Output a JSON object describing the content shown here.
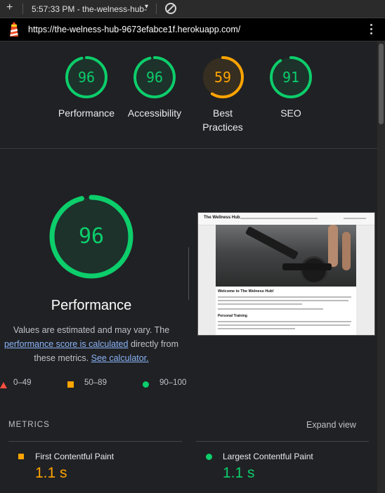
{
  "browser": {
    "new_tab_symbol": "+",
    "session_label": "5:57:33 PM - the-welness-hub-",
    "session_caret": "▾",
    "url": "https://the-welness-hub-9673efabce1f.herokuapp.com/"
  },
  "scores": [
    {
      "label": "Performance",
      "value": "96",
      "score": 0.96,
      "color": "#0cce6b"
    },
    {
      "label": "Accessibility",
      "value": "96",
      "score": 0.96,
      "color": "#0cce6b"
    },
    {
      "label": "Best Practices",
      "value": "59",
      "score": 0.59,
      "color": "#ffa400"
    },
    {
      "label": "SEO",
      "value": "91",
      "score": 0.91,
      "color": "#0cce6b"
    }
  ],
  "performance": {
    "value": "96",
    "score": 0.96,
    "title": "Performance",
    "note_1": "Values are estimated and may vary. The",
    "link_score": "performance score is calculated",
    "note_2": "directly from these metrics.",
    "link_calculator": "See calculator."
  },
  "legend": {
    "fail": "0–49",
    "average": "50–89",
    "pass": "90–100"
  },
  "screenshot": {
    "brand": "The Wellness Hub",
    "heading": "Welcome to The Welness Hub!",
    "subheading": "Personal Training"
  },
  "metrics": {
    "section_label": "METRICS",
    "expand_label": "Expand view",
    "items": [
      {
        "name": "First Contentful Paint",
        "value": "1.1 s",
        "color": "#ffa400"
      },
      {
        "name": "Largest Contentful Paint",
        "value": "1.1 s",
        "color": "#0cce6b"
      }
    ]
  },
  "colors": {
    "pass": "#0cce6b",
    "average": "#ffa400",
    "fail": "#ff4e42",
    "link": "#8ab4f8"
  }
}
